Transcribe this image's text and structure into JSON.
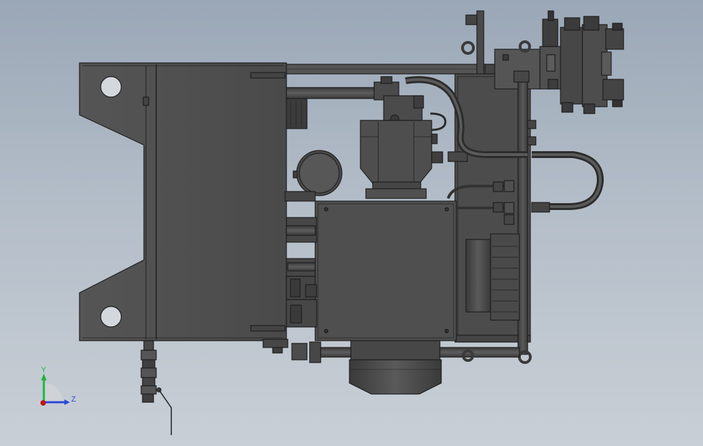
{
  "viewport": {
    "background_top": "#9aa7b6",
    "background_bottom": "#c9cfd6"
  },
  "model": {
    "body_color": "#4f4f4f",
    "dark_color": "#3c3c3c",
    "edge_color": "#1e1e1e",
    "light_color": "#5e5e5e"
  },
  "triad": {
    "y_label": "Y",
    "z_label": "Z",
    "y_color": "#1fb43c",
    "z_color": "#2a46d6",
    "origin_color": "#c0141e"
  }
}
